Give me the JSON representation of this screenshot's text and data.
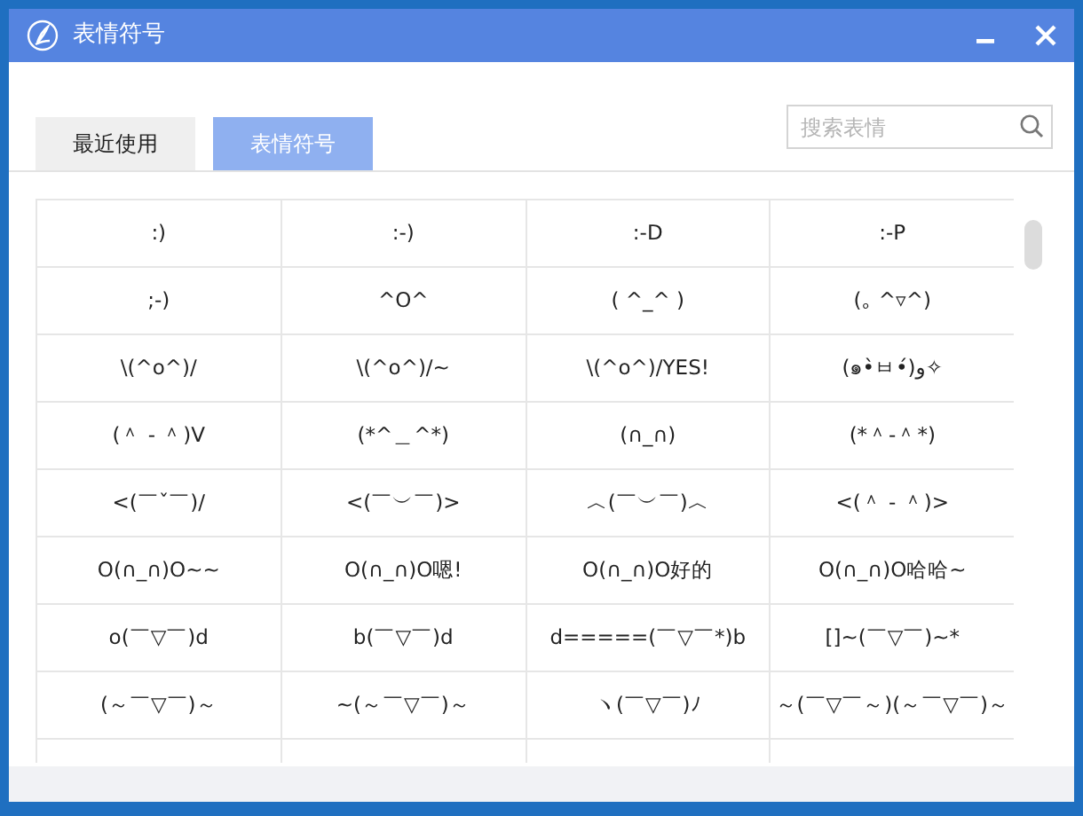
{
  "window": {
    "title": "表情符号"
  },
  "tabs": [
    {
      "label": "最近使用",
      "selected": false
    },
    {
      "label": "表情符号",
      "selected": true
    }
  ],
  "search": {
    "placeholder": "搜索表情"
  },
  "grid": {
    "rows": [
      [
        ":)",
        ":-)",
        ":-D",
        ":-P"
      ],
      [
        ";-)",
        "^O^",
        "( ^_^ )",
        "(｡ ^▿^)"
      ],
      [
        "\\(^o^)/",
        "\\(^o^)/~",
        "\\(^o^)/YES!",
        "(๑•̀ㅂ•́)و✧"
      ],
      [
        "(＾ - ＾)V",
        "(*^＿^*)",
        "(∩_∩)",
        "(*＾-＾*)"
      ],
      [
        "<(￣ˇ￣)/",
        "<(￣︶￣)>",
        "︿(￣︶￣)︿",
        "<(＾ - ＾)>"
      ],
      [
        "O(∩_∩)O~~",
        "O(∩_∩)O嗯!",
        "O(∩_∩)O好的",
        "O(∩_∩)O哈哈~"
      ],
      [
        "o(￣▽￣)d",
        "b(￣▽￣)d",
        "d=====(￣▽￣*)b",
        "[]~(￣▽￣)~*"
      ],
      [
        "(～￣▽￣)～",
        "~(～￣▽￣)～",
        "ヽ(￣▽￣)ﾉ",
        "～(￣▽￣～)(～￣▽￣)～"
      ]
    ]
  }
}
